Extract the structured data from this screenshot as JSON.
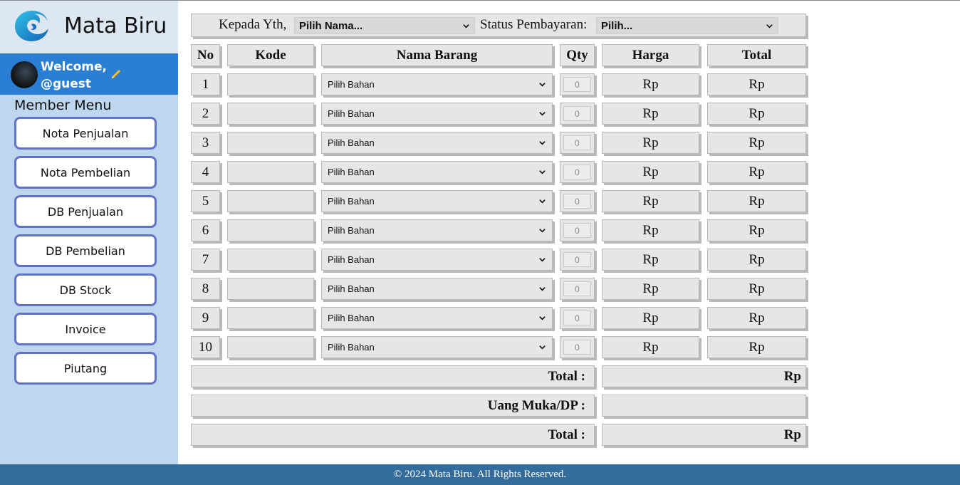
{
  "app": {
    "brand_name": "Mata Biru"
  },
  "user": {
    "welcome": "Welcome,",
    "handle": "@guest"
  },
  "sidebar": {
    "section_title": "Member Menu",
    "items": [
      {
        "label": "Nota Penjualan"
      },
      {
        "label": "Nota Pembelian"
      },
      {
        "label": "DB Penjualan"
      },
      {
        "label": "DB Pembelian"
      },
      {
        "label": "DB Stock"
      },
      {
        "label": "Invoice"
      },
      {
        "label": "Piutang"
      }
    ]
  },
  "form": {
    "recipient_label": "Kepada Yth,",
    "recipient_value": "Pilih Nama...",
    "payment_label": "Status Pembayaran:",
    "payment_value": "Pilih..."
  },
  "table": {
    "headers": {
      "no": "No",
      "kode": "Kode",
      "nama": "Nama Barang",
      "qty": "Qty",
      "harga": "Harga",
      "total": "Total"
    },
    "rows": [
      {
        "no": "1",
        "kode": "",
        "bahan": "Pilih Bahan",
        "qty": "0",
        "harga": "Rp",
        "total": "Rp"
      },
      {
        "no": "2",
        "kode": "",
        "bahan": "Pilih Bahan",
        "qty": "0",
        "harga": "Rp",
        "total": "Rp"
      },
      {
        "no": "3",
        "kode": "",
        "bahan": "Pilih Bahan",
        "qty": "0",
        "harga": "Rp",
        "total": "Rp"
      },
      {
        "no": "4",
        "kode": "",
        "bahan": "Pilih Bahan",
        "qty": "0",
        "harga": "Rp",
        "total": "Rp"
      },
      {
        "no": "5",
        "kode": "",
        "bahan": "Pilih Bahan",
        "qty": "0",
        "harga": "Rp",
        "total": "Rp"
      },
      {
        "no": "6",
        "kode": "",
        "bahan": "Pilih Bahan",
        "qty": "0",
        "harga": "Rp",
        "total": "Rp"
      },
      {
        "no": "7",
        "kode": "",
        "bahan": "Pilih Bahan",
        "qty": "0",
        "harga": "Rp",
        "total": "Rp"
      },
      {
        "no": "8",
        "kode": "",
        "bahan": "Pilih Bahan",
        "qty": "0",
        "harga": "Rp",
        "total": "Rp"
      },
      {
        "no": "9",
        "kode": "",
        "bahan": "Pilih Bahan",
        "qty": "0",
        "harga": "Rp",
        "total": "Rp"
      },
      {
        "no": "10",
        "kode": "",
        "bahan": "Pilih Bahan",
        "qty": "0",
        "harga": "Rp",
        "total": "Rp"
      }
    ]
  },
  "summary": [
    {
      "label": "Total :",
      "value": "Rp"
    },
    {
      "label": "Uang Muka/DP :",
      "value": ""
    },
    {
      "label": "Total :",
      "value": "Rp"
    }
  ],
  "footer": {
    "text": "© 2024 Mata Biru. All Rights Reserved."
  },
  "colors": {
    "sidebar_bg": "#bdd7ee",
    "welcome_bg": "#2a7fd4",
    "menu_border": "#6173c8",
    "footer_bg": "#336b9b"
  },
  "icons": {
    "logo": "mata-biru-logo",
    "pencil": "edit-pencil-icon",
    "chevron": "chevron-down-icon"
  }
}
